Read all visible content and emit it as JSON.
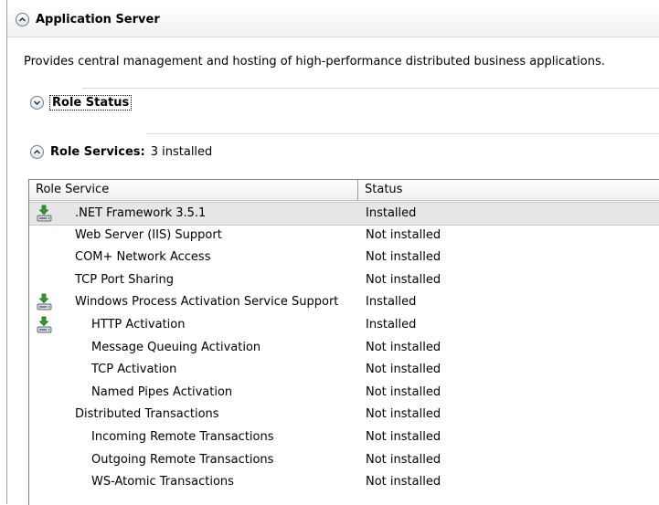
{
  "section": {
    "title": "Application Server",
    "description": "Provides central management and hosting of high-performance distributed business applications."
  },
  "role_status": {
    "label": "Role Status"
  },
  "role_services": {
    "label": "Role Services:",
    "count_text": "3 installed",
    "columns": [
      "Role Service",
      "Status"
    ],
    "rows": [
      {
        "name": ".NET Framework 3.5.1",
        "status": "Installed",
        "indent": 0,
        "icon": true
      },
      {
        "name": "Web Server (IIS) Support",
        "status": "Not installed",
        "indent": 0,
        "icon": false
      },
      {
        "name": "COM+ Network Access",
        "status": "Not installed",
        "indent": 0,
        "icon": false
      },
      {
        "name": "TCP Port Sharing",
        "status": "Not installed",
        "indent": 0,
        "icon": false
      },
      {
        "name": "Windows Process Activation Service Support",
        "status": "Installed",
        "indent": 0,
        "icon": true
      },
      {
        "name": "HTTP Activation",
        "status": "Installed",
        "indent": 1,
        "icon": true
      },
      {
        "name": "Message Queuing Activation",
        "status": "Not installed",
        "indent": 1,
        "icon": false
      },
      {
        "name": "TCP Activation",
        "status": "Not installed",
        "indent": 1,
        "icon": false
      },
      {
        "name": "Named Pipes Activation",
        "status": "Not installed",
        "indent": 1,
        "icon": false
      },
      {
        "name": "Distributed Transactions",
        "status": "Not installed",
        "indent": 0,
        "icon": false
      },
      {
        "name": "Incoming Remote Transactions",
        "status": "Not installed",
        "indent": 1,
        "icon": false
      },
      {
        "name": "Outgoing Remote Transactions",
        "status": "Not installed",
        "indent": 1,
        "icon": false
      },
      {
        "name": "WS-Atomic Transactions",
        "status": "Not installed",
        "indent": 1,
        "icon": false
      }
    ]
  },
  "colors": {
    "selected_row": "#e6e6e6",
    "install_arrow": "#2e9b2e"
  },
  "icons": {
    "collapse": "chevron-up-icon",
    "expand": "chevron-down-icon",
    "installed": "installed-server-icon"
  }
}
